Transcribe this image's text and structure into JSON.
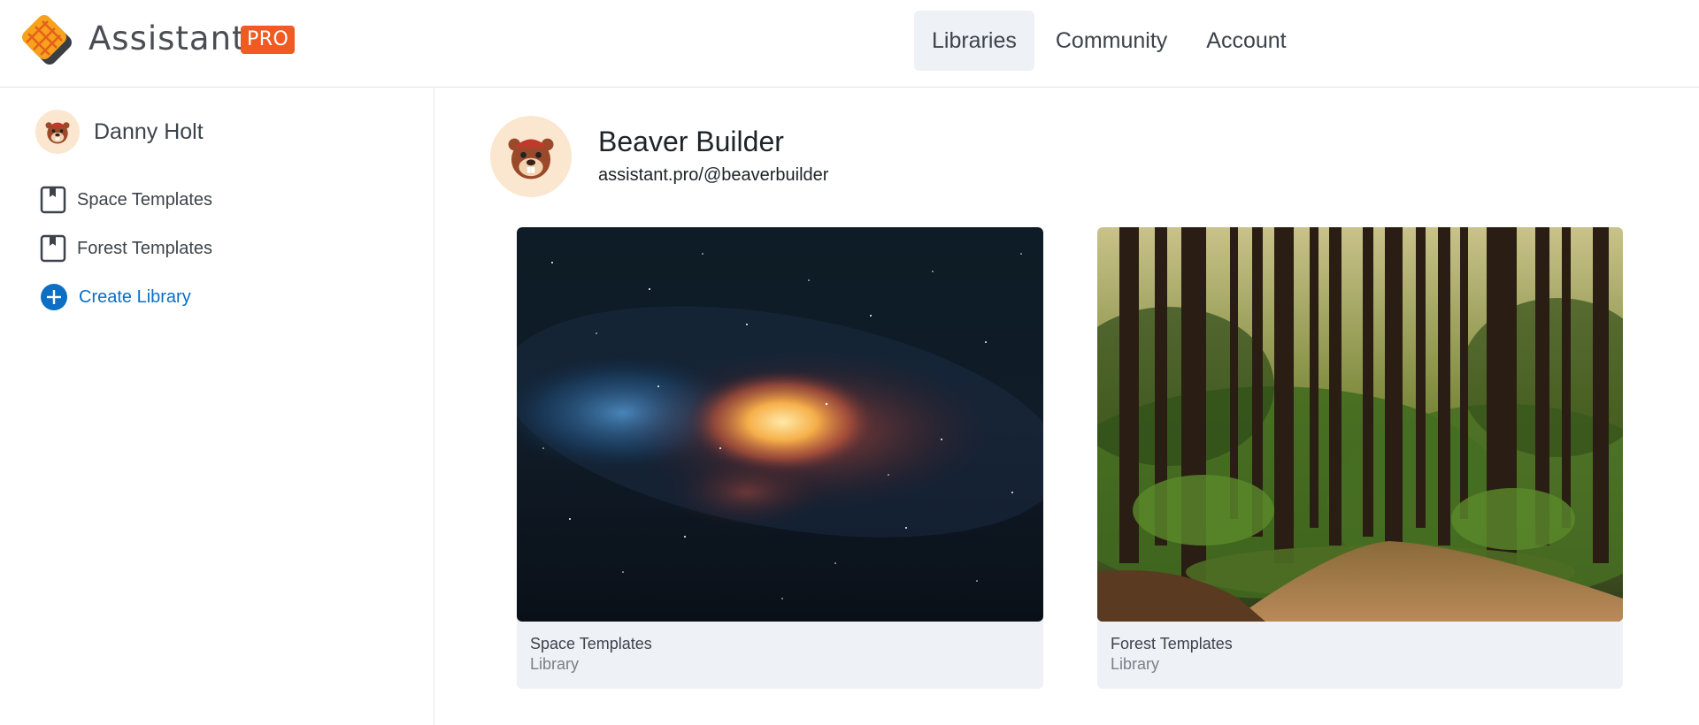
{
  "brand": {
    "name": "Assistant",
    "badge": "PRO"
  },
  "nav": {
    "items": [
      {
        "label": "Libraries",
        "active": true
      },
      {
        "label": "Community",
        "active": false
      },
      {
        "label": "Account",
        "active": false
      }
    ]
  },
  "sidebar": {
    "user_name": "Danny Holt",
    "items": [
      {
        "label": "Space Templates",
        "icon": "library-icon"
      },
      {
        "label": "Forest Templates",
        "icon": "library-icon"
      }
    ],
    "create_label": "Create Library"
  },
  "profile": {
    "name": "Beaver Builder",
    "handle": "assistant.pro/@beaverbuilder"
  },
  "libraries": [
    {
      "title": "Space Templates",
      "type": "Library"
    },
    {
      "title": "Forest Templates",
      "type": "Library"
    }
  ],
  "colors": {
    "accent": "#0b6fc5",
    "badge": "#f15a22",
    "nav_active_bg": "#eef1f6",
    "card_bg": "#eef1f6"
  }
}
